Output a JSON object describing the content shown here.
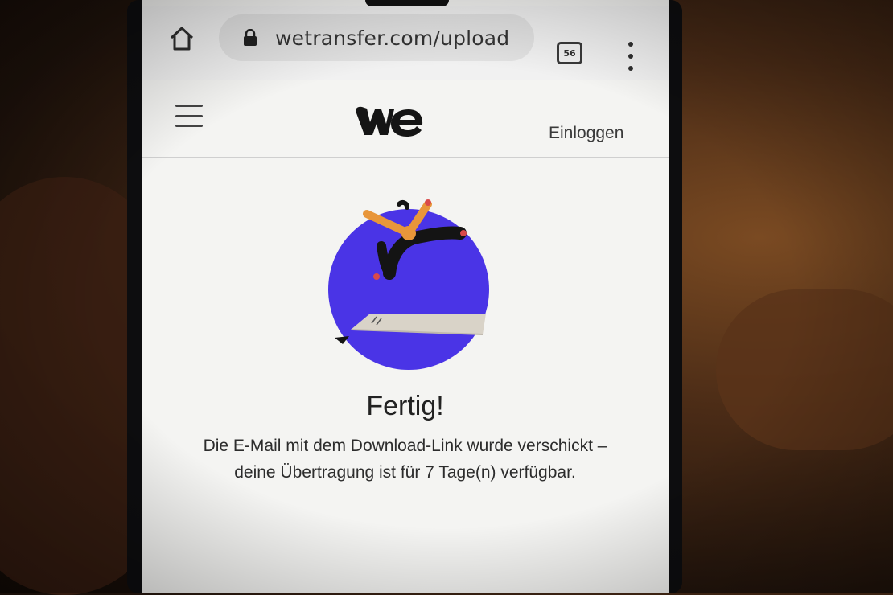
{
  "browser": {
    "url": "wetransfer.com/upload",
    "tab_count": "56",
    "icons": {
      "home": "home-icon",
      "lock": "lock-icon",
      "tabs": "tab-switcher-icon",
      "menu": "more-vert-icon"
    }
  },
  "site_header": {
    "logo_text": "we",
    "login_label": "Einloggen",
    "menu_icon": "hamburger-menu-icon"
  },
  "main": {
    "title": "Fertig!",
    "message": "Die E-Mail mit dem Download-Link wurde verschickt – deine Übertragung ist für 7 Tage(n) verfügbar."
  },
  "colors": {
    "illustration_circle": "#4a34e6",
    "figure_orange": "#e8963a",
    "figure_black": "#141414",
    "board": "#d8d2c6"
  }
}
